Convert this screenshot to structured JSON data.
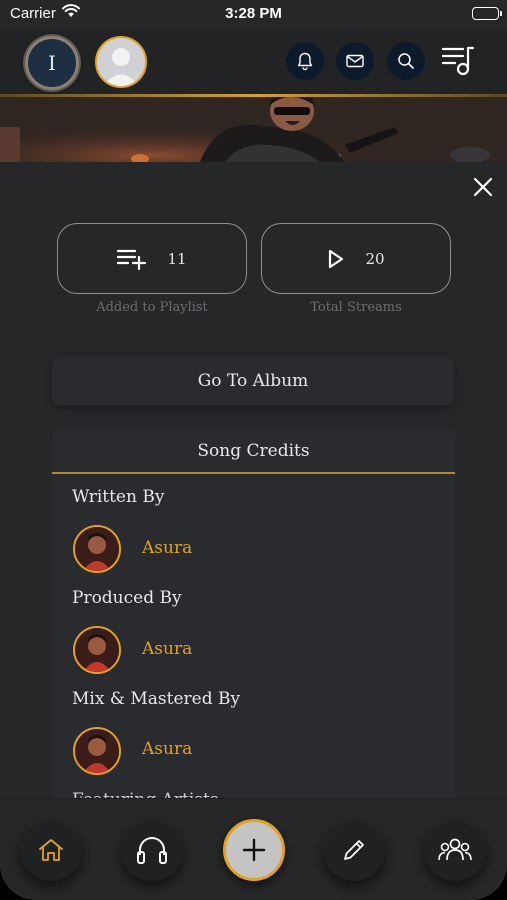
{
  "status_bar": {
    "carrier": "Carrier",
    "time": "3:28 PM"
  },
  "header": {
    "profile_initial": "I",
    "icons": [
      "bell-icon",
      "mail-icon",
      "search-icon",
      "music-queue-icon"
    ]
  },
  "stats": [
    {
      "icon": "playlist-add-icon",
      "value": "11",
      "label": "Added to Playlist"
    },
    {
      "icon": "play-icon",
      "value": "20",
      "label": "Total Streams"
    }
  ],
  "album_button": {
    "label": "Go To Album"
  },
  "credits": {
    "title": "Song Credits",
    "sections": [
      {
        "role": "Written By",
        "artist": "Asura"
      },
      {
        "role": "Produced By",
        "artist": "Asura"
      },
      {
        "role": "Mix & Mastered By",
        "artist": "Asura"
      },
      {
        "role": "Featuring Artists"
      }
    ]
  },
  "tab_bar": {
    "items": [
      "home-icon",
      "headphones-icon",
      "add-icon",
      "pencil-icon",
      "community-icon"
    ],
    "active": "home-icon"
  },
  "colors": {
    "accent": "#e2a21f",
    "background": "#262729",
    "card": "#2a2b2e",
    "header_button": "#0d1a2b"
  }
}
